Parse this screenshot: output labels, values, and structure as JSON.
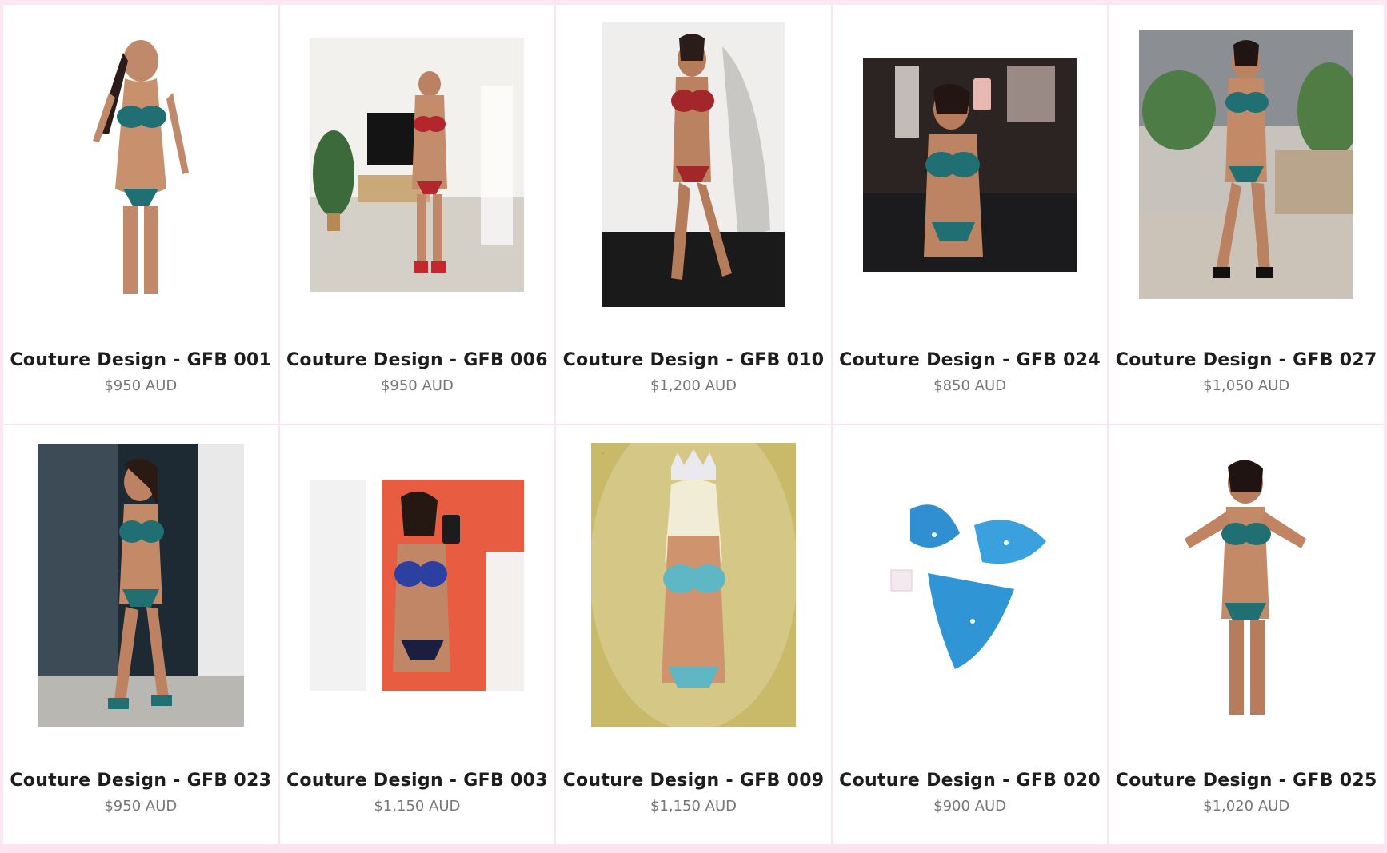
{
  "products": [
    {
      "title": "Couture Design - GFB 001",
      "price": "$950 AUD",
      "image": "photo-white-bg-teal-bikini"
    },
    {
      "title": "Couture Design - GFB 006",
      "price": "$950 AUD",
      "image": "photo-living-room-red-bikini"
    },
    {
      "title": "Couture Design - GFB 010",
      "price": "$1,200 AUD",
      "image": "photo-studio-red-bikini"
    },
    {
      "title": "Couture Design - GFB 024",
      "price": "$850 AUD",
      "image": "photo-backstage-selfie-teal-bikini"
    },
    {
      "title": "Couture Design - GFB 027",
      "price": "$1,050 AUD",
      "image": "photo-outdoor-teal-bikini"
    },
    {
      "title": "Couture Design - GFB 023",
      "price": "$950 AUD",
      "image": "photo-balcony-teal-bikini"
    },
    {
      "title": "Couture Design - GFB 003",
      "price": "$1,150 AUD",
      "image": "photo-selfie-blue-bikini"
    },
    {
      "title": "Couture Design - GFB 009",
      "price": "$1,150 AUD",
      "image": "photo-crown-teal-bikini"
    },
    {
      "title": "Couture Design - GFB 020",
      "price": "$900 AUD",
      "image": "photo-product-blue-bikini"
    },
    {
      "title": "Couture Design - GFB 025",
      "price": "$1,020 AUD",
      "image": "photo-white-bg-teal-bikini-2"
    }
  ],
  "colors": {
    "page_bg": "#fce6f1",
    "card_bg": "#ffffff",
    "title": "#1d1d1d",
    "price": "#777777",
    "teal": "#1f6f73",
    "red": "#b3262b",
    "blue": "#2f8fd0"
  }
}
